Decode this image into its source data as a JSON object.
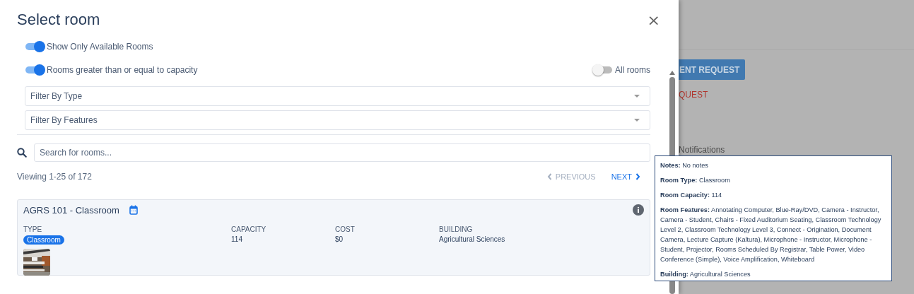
{
  "dialog": {
    "title": "Select room",
    "close": "×"
  },
  "toggles": [
    {
      "label": "Show Only Available Rooms",
      "on": true
    },
    {
      "label": "Rooms greater than or equal to capacity",
      "on": true
    },
    {
      "label": "All rooms",
      "on": false
    }
  ],
  "filters": [
    {
      "placeholder": "Filter By Type"
    },
    {
      "placeholder": "Filter By Features"
    }
  ],
  "search": {
    "placeholder": "Search for rooms..."
  },
  "pagination": {
    "summary": "Viewing 1-25 of 172",
    "previous": {
      "label": "PREVIOUS",
      "disabled": true
    },
    "next": {
      "label": "NEXT",
      "disabled": false
    }
  },
  "rooms": [
    {
      "name": "AGRS 101 - Classroom",
      "columns": [
        {
          "heading": "TYPE",
          "value": "Classroom",
          "kind": "badge"
        },
        {
          "heading": "CAPACITY",
          "value": "114",
          "kind": "text"
        },
        {
          "heading": "COST",
          "value": "$0",
          "kind": "text"
        },
        {
          "heading": "BUILDING",
          "value": "Agricultural Sciences",
          "kind": "text"
        }
      ],
      "photo": {
        "kind": "picture"
      }
    }
  ],
  "tooltip": {
    "lines": [
      "**Notes:** No notes",
      "**Room Type:** Classroom",
      "**Room Capacity:** 114",
      "**Room Features:** Annotating Computer, Blue-Ray/DVD, Camera - Instructor, Camera - Student, Chairs - Fixed Auditorium Seating, Classroom Technology Level 2, Classroom Technology Level 3, Connect - Origination, Document Camera, Lecture Capture (Kaltura), Microphone - Instructor, Microphone - Student, Projector, Rooms Scheduled By Registrar, Table Power, Video Conference (Simple), Voice Amplification, Whiteboard",
      "**Building:** Agricultural Sciences"
    ]
  },
  "background": {
    "button": "ENT REQUEST",
    "link": "QUEST",
    "section": "Notifications"
  }
}
